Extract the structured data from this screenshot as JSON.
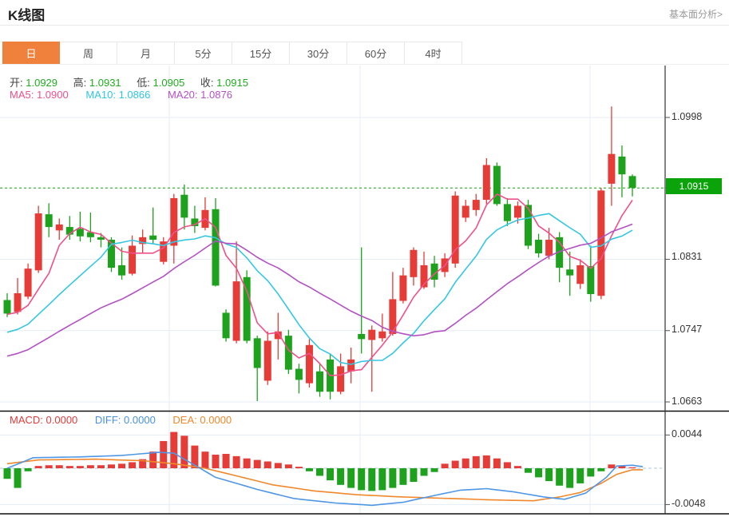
{
  "header": {
    "title": "K线图",
    "link": "基本面分析>"
  },
  "tabs": {
    "items": [
      "日",
      "周",
      "月",
      "5分",
      "15分",
      "30分",
      "60分",
      "4时"
    ],
    "active": 0
  },
  "ohlc_legend": {
    "open_label": "开:",
    "open": "1.0929",
    "high_label": "高:",
    "high": "1.0931",
    "low_label": "低:",
    "low": "1.0905",
    "close_label": "收:",
    "close": "1.0915"
  },
  "ma_legend": {
    "ma5_label": "MA5:",
    "ma5": "1.0900",
    "ma10_label": "MA10:",
    "ma10": "1.0866",
    "ma20_label": "MA20:",
    "ma20": "1.0876"
  },
  "macd_legend": {
    "macd_label": "MACD:",
    "macd": "0.0000",
    "diff_label": "DIFF:",
    "diff": "0.0000",
    "dea_label": "DEA:",
    "dea": "0.0000"
  },
  "price_axis": {
    "labels": [
      "1.0998",
      "1.0831",
      "1.0747",
      "1.0663"
    ],
    "current": "1.0915"
  },
  "macd_axis": {
    "labels": [
      "0.0044",
      "-0.0048"
    ]
  },
  "colors": {
    "up": "#e53c38",
    "down": "#1ea21e",
    "ma5": "#f0508a",
    "ma10": "#35c7e2",
    "ma20": "#b351c3",
    "diff": "#4f97e5",
    "dea": "#f0882c",
    "grid": "#e4edf5",
    "zero_dash": "#a9cbe3",
    "current_line": "#12a112",
    "badge": "#0aa30a",
    "tab_active": "#f0813d",
    "axis": "#333333"
  },
  "chart_data": {
    "type": "candlestick",
    "title": "K线图 (daily K-line with MA5/MA10/MA20 and MACD)",
    "legend_position": "top-left",
    "grid": true,
    "price_ticks": [
      1.0998,
      1.0915,
      1.0831,
      1.0747,
      1.0663
    ],
    "current_price": 1.0915,
    "candle_convention": "red = up (close>=open), green = down",
    "candles_ohlc": [
      [
        1.0783,
        1.0791,
        1.0763,
        1.0767
      ],
      [
        1.0769,
        1.0809,
        1.0766,
        1.0791
      ],
      [
        1.0787,
        1.0826,
        1.0784,
        1.082
      ],
      [
        1.0818,
        1.0894,
        1.0815,
        1.0885
      ],
      [
        1.0884,
        1.0897,
        1.0857,
        1.0869
      ],
      [
        1.0865,
        1.0879,
        1.0854,
        1.0872
      ],
      [
        1.0869,
        1.0882,
        1.0854,
        1.086
      ],
      [
        1.0867,
        1.0887,
        1.0852,
        1.0858
      ],
      [
        1.0863,
        1.0886,
        1.0851,
        1.0857
      ],
      [
        1.0857,
        1.0862,
        1.0845,
        1.0854
      ],
      [
        1.0854,
        1.0857,
        1.0816,
        1.0821
      ],
      [
        1.0824,
        1.0845,
        1.0807,
        1.0812
      ],
      [
        1.0814,
        1.0859,
        1.0812,
        1.0847
      ],
      [
        1.0849,
        1.0866,
        1.0838,
        1.0857
      ],
      [
        1.0859,
        1.0892,
        1.0849,
        1.0854
      ],
      [
        1.0828,
        1.0857,
        1.0825,
        1.0852
      ],
      [
        1.0847,
        1.0908,
        1.0826,
        1.0903
      ],
      [
        1.0907,
        1.0919,
        1.0866,
        1.088
      ],
      [
        1.0879,
        1.0894,
        1.0862,
        1.087
      ],
      [
        1.0868,
        1.0904,
        1.0865,
        1.0889
      ],
      [
        1.089,
        1.0903,
        1.0799,
        1.08
      ],
      [
        1.0768,
        1.0772,
        1.0734,
        1.0738
      ],
      [
        1.0735,
        1.0852,
        1.0732,
        1.0805
      ],
      [
        1.081,
        1.0818,
        1.0732,
        1.0735
      ],
      [
        1.0738,
        1.0741,
        1.0664,
        1.0703
      ],
      [
        1.0688,
        1.0746,
        1.0683,
        1.0735
      ],
      [
        1.0737,
        1.0768,
        1.0713,
        1.0746
      ],
      [
        1.0741,
        1.0748,
        1.0696,
        1.0701
      ],
      [
        1.0702,
        1.0708,
        1.0673,
        1.0689
      ],
      [
        1.0685,
        1.0737,
        1.068,
        1.073
      ],
      [
        1.0699,
        1.0708,
        1.0669,
        1.0675
      ],
      [
        1.0713,
        1.072,
        1.0666,
        1.0675
      ],
      [
        1.0675,
        1.072,
        1.0672,
        1.0705
      ],
      [
        1.0699,
        1.0727,
        1.0685,
        1.0713
      ],
      [
        1.0743,
        1.0845,
        1.072,
        1.0737
      ],
      [
        1.0736,
        1.0753,
        1.0675,
        1.0748
      ],
      [
        1.0738,
        1.0767,
        1.0734,
        1.0746
      ],
      [
        1.0743,
        1.0816,
        1.0741,
        1.0784
      ],
      [
        1.0782,
        1.0821,
        1.0779,
        1.0812
      ],
      [
        1.081,
        1.0845,
        1.08,
        1.0842
      ],
      [
        1.0798,
        1.084,
        1.0796,
        1.0824
      ],
      [
        1.0826,
        1.0835,
        1.0798,
        1.0807
      ],
      [
        1.0816,
        1.0838,
        1.081,
        1.0832
      ],
      [
        1.0826,
        1.0911,
        1.0821,
        1.0906
      ],
      [
        1.088,
        1.0901,
        1.0875,
        1.0894
      ],
      [
        1.0889,
        1.0908,
        1.0882,
        1.0901
      ],
      [
        1.0901,
        1.095,
        1.0896,
        1.0942
      ],
      [
        1.0941,
        1.0945,
        1.0894,
        1.0896
      ],
      [
        1.0896,
        1.0903,
        1.087,
        1.0876
      ],
      [
        1.088,
        1.0899,
        1.0873,
        1.0894
      ],
      [
        1.0895,
        1.0901,
        1.0843,
        1.0847
      ],
      [
        1.0854,
        1.0861,
        1.0833,
        1.0838
      ],
      [
        1.0835,
        1.0868,
        1.0831,
        1.0854
      ],
      [
        1.0857,
        1.0863,
        1.0804,
        1.0821
      ],
      [
        1.0819,
        1.084,
        1.0788,
        1.0812
      ],
      [
        1.0802,
        1.0831,
        1.0796,
        1.0824
      ],
      [
        1.0823,
        1.0847,
        1.0781,
        1.079
      ],
      [
        1.0788,
        1.0915,
        1.0784,
        1.0912
      ],
      [
        1.092,
        1.1011,
        1.0894,
        1.0955
      ],
      [
        1.0952,
        1.0965,
        1.0904,
        1.0931
      ],
      [
        1.0929,
        1.0931,
        1.0905,
        1.0915
      ]
    ],
    "ma_periods": [
      5,
      10,
      20
    ],
    "ma_left_values": {
      "ma5": 1.0766,
      "ma10": 1.0745,
      "ma20": 1.0717
    },
    "ma_last_values": {
      "ma5": 1.09,
      "ma10": 1.0866,
      "ma20": 1.0876
    },
    "macd": {
      "axis_ticks": [
        0.0044,
        -0.0048
      ],
      "histogram": [
        -0.0014,
        -0.0026,
        -0.0004,
        0.0003,
        0.0004,
        0.0004,
        0.0003,
        0.0003,
        0.0004,
        0.0004,
        0.0005,
        0.0006,
        0.0008,
        0.0012,
        0.0022,
        0.0036,
        0.0048,
        0.0043,
        0.003,
        0.0022,
        0.0018,
        0.0019,
        0.0016,
        0.0013,
        0.0011,
        0.0009,
        0.0007,
        0.0005,
        0.0002,
        -0.0004,
        -0.001,
        -0.0016,
        -0.0022,
        -0.0026,
        -0.0029,
        -0.003,
        -0.0029,
        -0.0026,
        -0.0022,
        -0.0018,
        -0.001,
        -0.0005,
        0.0006,
        0.001,
        0.0013,
        0.0016,
        0.0017,
        0.0013,
        0.0008,
        0.0003,
        -0.0006,
        -0.0012,
        -0.0017,
        -0.0023,
        -0.0026,
        -0.002,
        -0.0011,
        -0.0004,
        0.0005,
        0.0003,
        0.0001
      ],
      "diff_points": [
        [
          0,
          0.0
        ],
        [
          2.5,
          0.0014
        ],
        [
          7,
          0.0015
        ],
        [
          11,
          0.0017
        ],
        [
          14.5,
          0.0021
        ],
        [
          16,
          0.002
        ],
        [
          17.5,
          0.0008
        ],
        [
          20,
          -0.0012
        ],
        [
          24,
          -0.0028
        ],
        [
          27.5,
          -0.004
        ],
        [
          31.5,
          -0.0046
        ],
        [
          35,
          -0.0049
        ],
        [
          38,
          -0.0045
        ],
        [
          41,
          -0.0036
        ],
        [
          43.5,
          -0.0029
        ],
        [
          46,
          -0.0027
        ],
        [
          48.5,
          -0.0031
        ],
        [
          51.5,
          -0.0038
        ],
        [
          53.5,
          -0.0041
        ],
        [
          55.5,
          -0.0033
        ],
        [
          57.5,
          -0.0012
        ],
        [
          58.5,
          0.0003
        ],
        [
          60,
          0.0004
        ],
        [
          61,
          0.0002
        ]
      ],
      "dea_points": [
        [
          0,
          0.0006
        ],
        [
          3,
          0.0011
        ],
        [
          8.5,
          0.0012
        ],
        [
          13,
          0.001
        ],
        [
          16,
          0.0006
        ],
        [
          19,
          0.0
        ],
        [
          22,
          -0.001
        ],
        [
          25.5,
          -0.0022
        ],
        [
          29.5,
          -0.003
        ],
        [
          33.5,
          -0.0035
        ],
        [
          38,
          -0.0038
        ],
        [
          42.5,
          -0.004
        ],
        [
          47,
          -0.0042
        ],
        [
          50.5,
          -0.0043
        ],
        [
          53,
          -0.0038
        ],
        [
          55,
          -0.0032
        ],
        [
          57,
          -0.002
        ],
        [
          58.5,
          -0.0008
        ],
        [
          60,
          -0.0002
        ],
        [
          61,
          -0.0002
        ]
      ]
    }
  }
}
